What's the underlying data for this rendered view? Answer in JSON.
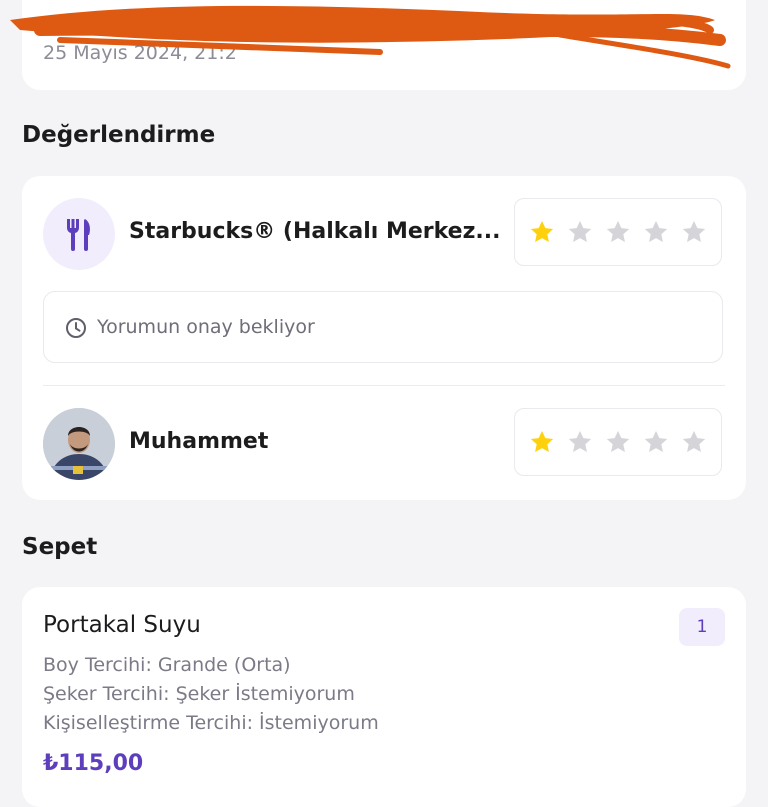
{
  "order": {
    "date": "25 Mayıs 2024, 21:2"
  },
  "rating": {
    "section_title": "Değerlendirme",
    "restaurant": {
      "name": "Starbucks® (Halkalı Merkez...",
      "icon": "fork-knife-icon",
      "stars": 1,
      "max_stars": 5
    },
    "comment_status": "Yorumun onay bekliyor",
    "courier": {
      "name": "Muhammet",
      "stars": 1,
      "max_stars": 5
    }
  },
  "basket": {
    "section_title": "Sepet",
    "items": [
      {
        "name": "Portakal Suyu",
        "quantity": "1",
        "options": [
          "Boy Tercihi: Grande (Orta)",
          "Şeker Tercihi: Şeker İstemiyorum",
          "Kişiselleştirme Tercihi: İstemiyorum"
        ],
        "price": "₺115,00"
      }
    ]
  },
  "colors": {
    "accent": "#5d3ebc",
    "star_active": "#ffd10d",
    "star_inactive": "#d4d4d9",
    "background": "#f4f4f6"
  }
}
